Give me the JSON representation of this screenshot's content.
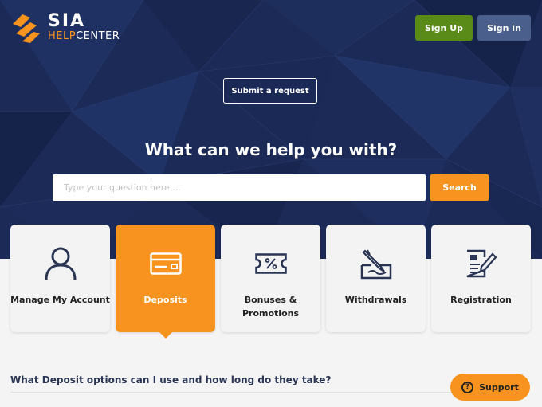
{
  "logo": {
    "name": "SIA",
    "sub_help": "HELP",
    "sub_center": "CENTER"
  },
  "header": {
    "signup_label": "Sign Up",
    "signin_label": "Sign in"
  },
  "hero": {
    "submit_label": "Submit a request",
    "title": "What can we help you with?",
    "search_placeholder": "Type your question here ...",
    "search_label": "Search"
  },
  "categories": [
    {
      "label": "Manage My Account",
      "icon": "user-icon",
      "active": false
    },
    {
      "label": "Deposits",
      "icon": "credit-card-icon",
      "active": true
    },
    {
      "label": "Bonuses &",
      "label2": "Promotions",
      "icon": "ticket-percent-icon",
      "active": false
    },
    {
      "label": "Withdrawals",
      "icon": "signing-pen-icon",
      "active": false
    },
    {
      "label": "Registration",
      "icon": "document-pen-icon",
      "active": false
    }
  ],
  "faq": {
    "question": "What Deposit options can I use and how long do they take?"
  },
  "support": {
    "label": "Support",
    "icon_glyph": "?"
  },
  "colors": {
    "hero_bg": "#1b2a57",
    "accent": "#f7931e",
    "signup": "#5a8a17",
    "signin": "#4b5f8c"
  }
}
